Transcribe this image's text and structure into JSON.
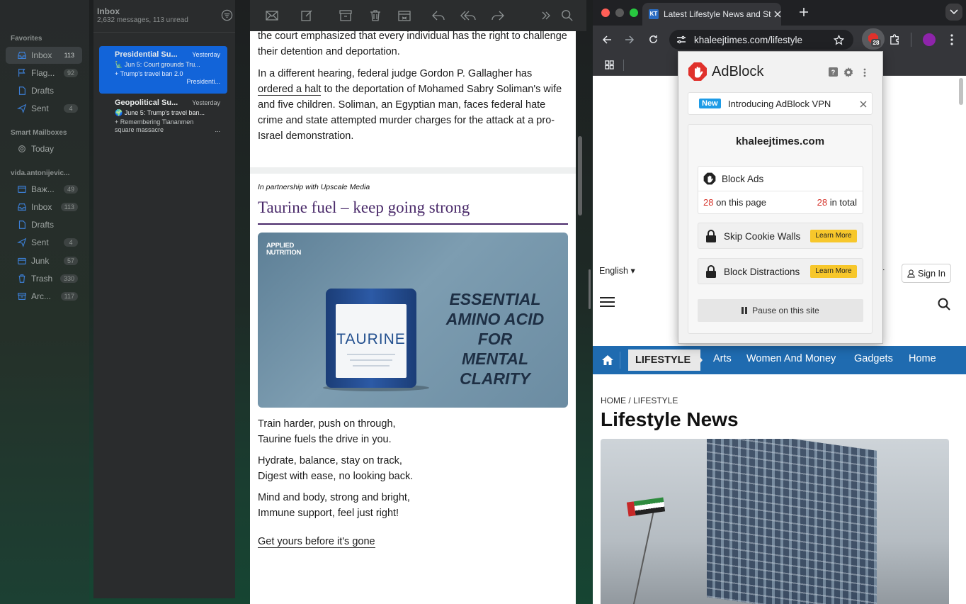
{
  "mail": {
    "sidebar": {
      "favorites_header": "Favorites",
      "favorites": [
        {
          "label": "Inbox",
          "count": "113"
        },
        {
          "label": "Flag...",
          "count": "92"
        },
        {
          "label": "Drafts",
          "count": ""
        },
        {
          "label": "Sent",
          "count": "4"
        }
      ],
      "smart_header": "Smart Mailboxes",
      "smart": [
        {
          "label": "Today"
        }
      ],
      "account_header": "vida.antonijevic...",
      "account": [
        {
          "label": "Важ...",
          "count": "49"
        },
        {
          "label": "Inbox",
          "count": "113"
        },
        {
          "label": "Drafts",
          "count": ""
        },
        {
          "label": "Sent",
          "count": "4"
        },
        {
          "label": "Junk",
          "count": "57"
        },
        {
          "label": "Trash",
          "count": "330"
        },
        {
          "label": "Arc...",
          "count": "117"
        }
      ]
    },
    "list": {
      "title": "Inbox",
      "subtitle": "2,632 messages, 113 unread",
      "messages": [
        {
          "from": "Presidential Su...",
          "date": "Yesterday",
          "subject": "🗽 Jun 5: Court grounds Tru...",
          "preview": "+ Trump's travel ban 2.0",
          "preview2": "Presidenti..."
        },
        {
          "from": "Geopolitical Su...",
          "date": "Yesterday",
          "subject": "🌍 June 5: Trump's travel ban...",
          "preview": "+ Remembering Tiananmen",
          "preview2": "square massacre",
          "preview3": "..."
        }
      ]
    },
    "content": {
      "p1": "the court emphasized that every individual has the right to challenge their detention and deportation.",
      "p2a": "In a different hearing, federal judge Gordon P. Gallagher has ",
      "p2link": "ordered a halt",
      "p2b": " to the deportation of Mohamed Sabry Soliman's wife and five children. Soliman, an Egyptian man, faces federal hate crime and state attempted murder charges for the attack at a pro-Israel demonstration.",
      "partner": "In partnership with Upscale Media",
      "ad_title": "Taurine fuel – keep going strong",
      "ad_brand": "APPLIED NUTRITION",
      "ad_product": "TAURINE",
      "ad_tagline_1": "ESSENTIAL",
      "ad_tagline_2": "AMINO ACID FOR",
      "ad_tagline_3": "MENTAL CLARITY",
      "poem": [
        [
          "Train harder, push on through,",
          "Taurine fuels the drive in you."
        ],
        [
          "Hydrate, balance, stay on track,",
          "Digest with ease, no looking back."
        ],
        [
          "Mind and body, strong and bright,",
          "Immune support, feel just right!"
        ]
      ],
      "cta": "Get yours before it's gone"
    }
  },
  "browser": {
    "tab_title": "Latest Lifestyle News and Sto",
    "url": "khaleejtimes.com/lifestyle",
    "badge_count": "28",
    "site": {
      "language": "English",
      "sign_in": "Sign In",
      "partial_button": "er",
      "nav": [
        "LIFESTYLE",
        "Arts",
        "Women And Money",
        "Gadgets",
        "Home"
      ],
      "breadcrumb": "HOME / LIFESTYLE",
      "heading": "Lifestyle News"
    },
    "adblock": {
      "brand": "AdBlock",
      "new_badge": "New",
      "promo": "Introducing AdBlock VPN",
      "domain": "khaleejtimes.com",
      "block_ads": "Block Ads",
      "page_count": "28",
      "page_label": "on this page",
      "total_count": "28",
      "total_label": "in total",
      "skip_cookie": "Skip Cookie Walls",
      "block_distractions": "Block Distractions",
      "learn_more": "Learn More",
      "pause": "Pause on this site"
    }
  }
}
